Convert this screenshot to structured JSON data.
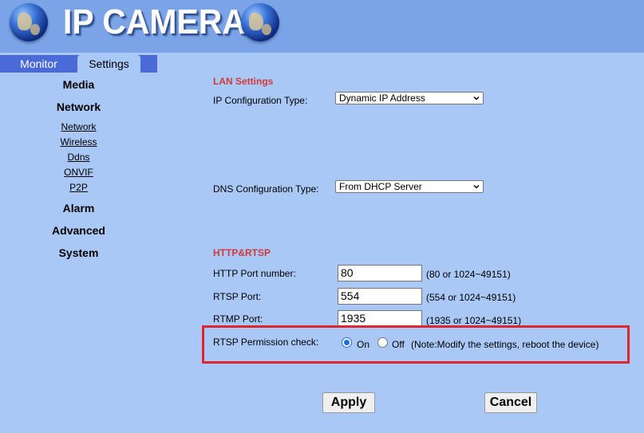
{
  "header": {
    "title": "IP CAMERA"
  },
  "sidebar": {
    "tabs": [
      {
        "label": "Monitor"
      },
      {
        "label": "Settings"
      }
    ],
    "menu": {
      "media": "Media",
      "network": "Network",
      "network_items": [
        "Network",
        "Wireless",
        "Ddns",
        "ONVIF",
        "P2P"
      ],
      "alarm": "Alarm",
      "advanced": "Advanced",
      "system": "System"
    }
  },
  "main": {
    "lan": {
      "title": "LAN Settings",
      "ip_config_label": "IP Configuration Type:",
      "ip_config_value": "Dynamic IP Address",
      "dns_config_label": "DNS Configuration Type:",
      "dns_config_value": "From DHCP Server"
    },
    "http_rtsp": {
      "title": "HTTP&RTSP",
      "http_port_label": "HTTP Port number:",
      "http_port_value": "80",
      "http_port_hint": "(80 or 1024~49151)",
      "rtsp_port_label": "RTSP Port:",
      "rtsp_port_value": "554",
      "rtsp_port_hint": "(554 or 1024~49151)",
      "rtmp_port_label": "RTMP Port:",
      "rtmp_port_value": "1935",
      "rtmp_port_hint": "(1935 or 1024~49151)",
      "rtsp_perm_label": "RTSP Permission check:",
      "rtsp_perm_on": "On",
      "rtsp_perm_off": "Off",
      "rtsp_perm_note": "(Note:Modify the settings, reboot the device)",
      "rtsp_perm_selected": "On"
    },
    "buttons": {
      "apply": "Apply",
      "cancel": "Cancel"
    }
  },
  "colors": {
    "background": "#a9c8f5",
    "tab_bar": "#4a6ad8",
    "section_title": "#d23a3a",
    "highlight_border": "#e0242c",
    "radio_accent": "#1a6fe0"
  }
}
